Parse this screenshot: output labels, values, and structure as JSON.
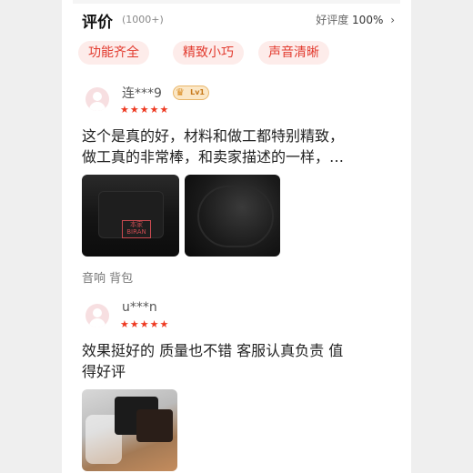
{
  "header": {
    "title": "评价",
    "count": "(1000+)",
    "rate_label": "好评度",
    "rate_value": "100%",
    "chevron": "›"
  },
  "tags": [
    "功能齐全",
    "精致小巧",
    "声音清晰"
  ],
  "reviews": [
    {
      "username": "连***9",
      "badge_icon": "crown-icon",
      "badge_level": "Lv1",
      "stars": "★★★★★",
      "text_line1": "这个是真的好，材料和做工都特别精致，",
      "text_line2": "做工真的非常棒，和卖家描述的一样，…",
      "photo_label": "本家 BIRAN",
      "meta": "音响  背包"
    },
    {
      "username": "u***n",
      "stars": "★★★★★",
      "text_line1": "效果挺好的 质量也不错 客服认真负责 值",
      "text_line2": "得好评"
    }
  ],
  "colors": {
    "accent": "#e23a2e",
    "tag_bg": "#fdecea",
    "star": "#ee3a22"
  }
}
